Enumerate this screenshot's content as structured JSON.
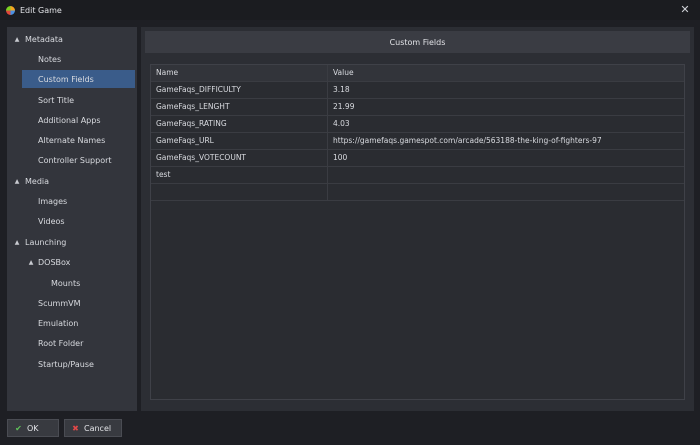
{
  "window": {
    "title": "Edit Game",
    "close_glyph": "✕"
  },
  "sidebar": {
    "items": [
      {
        "label": "Metadata",
        "expander": "▲"
      },
      {
        "label": "Notes"
      },
      {
        "label": "Custom Fields"
      },
      {
        "label": "Sort Title"
      },
      {
        "label": "Additional Apps"
      },
      {
        "label": "Alternate Names"
      },
      {
        "label": "Controller Support"
      },
      {
        "label": "Media",
        "expander": "▲"
      },
      {
        "label": "Images"
      },
      {
        "label": "Videos"
      },
      {
        "label": "Launching",
        "expander": "▲"
      },
      {
        "label": "DOSBox",
        "expander": "▲"
      },
      {
        "label": "Mounts"
      },
      {
        "label": "ScummVM"
      },
      {
        "label": "Emulation"
      },
      {
        "label": "Root Folder"
      },
      {
        "label": "Startup/Pause"
      }
    ]
  },
  "main": {
    "header": "Custom Fields",
    "table": {
      "columns": [
        "Name",
        "Value"
      ],
      "rows": [
        [
          "GameFaqs_DIFFICULTY",
          "3.18"
        ],
        [
          "GameFaqs_LENGHT",
          "21.99"
        ],
        [
          "GameFaqs_RATING",
          "4.03"
        ],
        [
          "GameFaqs_URL",
          "https://gamefaqs.gamespot.com/arcade/563188-the-king-of-fighters-97"
        ],
        [
          "GameFaqs_VOTECOUNT",
          "100"
        ],
        [
          "test",
          ""
        ],
        [
          "",
          ""
        ]
      ]
    }
  },
  "footer": {
    "ok_label": "OK",
    "cancel_label": "Cancel",
    "ok_icon": "✔",
    "cancel_icon": "✖"
  },
  "colors": {
    "selected": "#3a5c8a",
    "ok_icon": "#5fc35a",
    "cancel_icon": "#e04848"
  }
}
